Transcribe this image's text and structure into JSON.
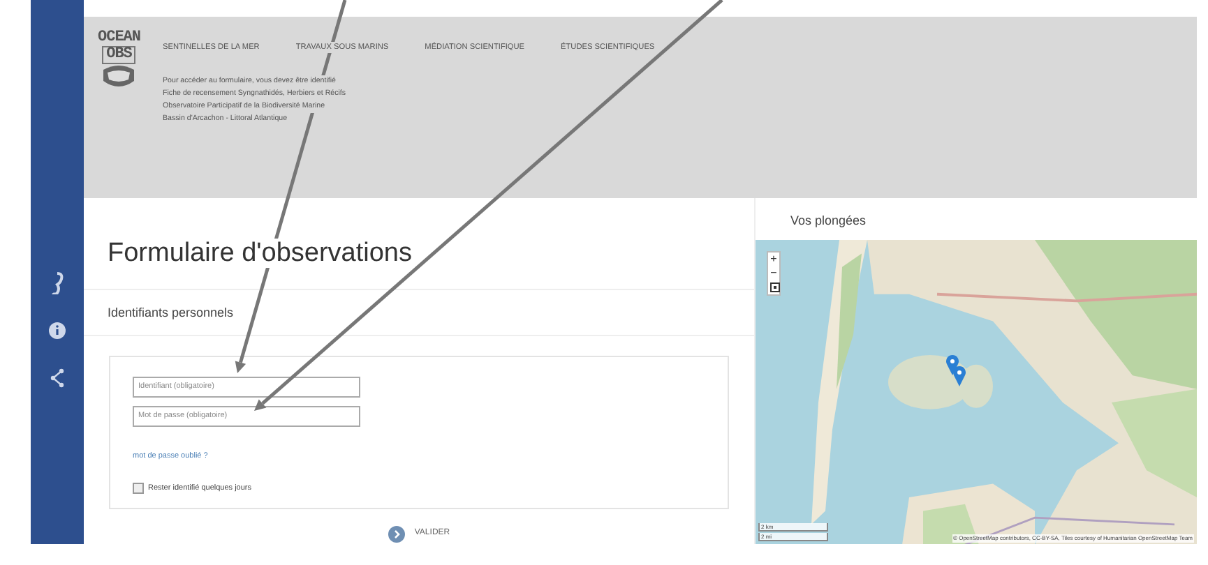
{
  "logo": {
    "line_1": "OCEAN",
    "line_2": "OBS"
  },
  "nav": [
    {
      "label": "SENTINELLES DE LA MER"
    },
    {
      "label": "TRAVAUX SOUS MARINS"
    },
    {
      "label": "MÉDIATION SCIENTIFIQUE"
    },
    {
      "label": "ÉTUDES SCIENTIFIQUES"
    }
  ],
  "header_lines": [
    "Pour accéder au formulaire, vous devez être identifié",
    "Fiche de recensement Syngnathidés, Herbiers et Récifs",
    "Observatoire Participatif de la Biodiversité Marine",
    "Bassin d'Arcachon - Littoral Atlantique"
  ],
  "sidebar": [
    {
      "kind": "seahorse"
    },
    {
      "kind": "info"
    },
    {
      "kind": "share"
    }
  ],
  "form": {
    "title": "Formulaire d'observations",
    "section": "Identifiants personnels",
    "fields": [
      {
        "placeholder": "Identifiant (obligatoire)"
      },
      {
        "placeholder": "Mot de passe (obligatoire)"
      }
    ],
    "forgot_link": "mot de passe oublié ?",
    "remember": {
      "label": "Rester identifié quelques jours",
      "checked": false
    },
    "submit": "VALIDER"
  },
  "map_panel": {
    "title": "Vos plongées",
    "zoom_in": "+",
    "zoom_out": "−",
    "scale": [
      "2 km",
      "2 mi"
    ],
    "attribution": "© OpenStreetMap contributors, CC-BY-SA, Tiles courtesy of Humanitarian OpenStreetMap Team",
    "markers": [
      {
        "kind": "pin"
      },
      {
        "kind": "pin"
      }
    ]
  },
  "annotations": [
    {
      "kind": "arrow"
    },
    {
      "kind": "arrow"
    }
  ]
}
